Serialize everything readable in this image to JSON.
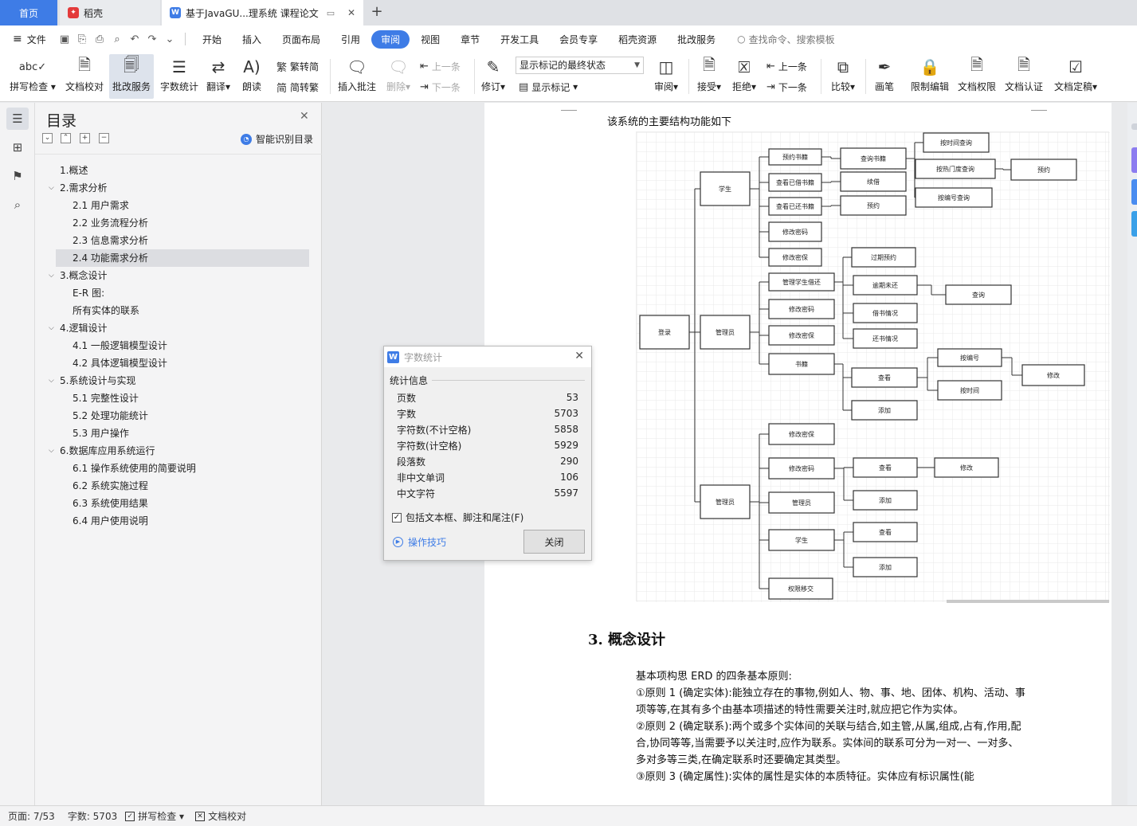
{
  "tabs": {
    "home": "首页",
    "daoke": "稻壳",
    "doc": "基于JavaGU...理系统 课程论文",
    "add": "+"
  },
  "menu": {
    "file": "文件",
    "items": [
      "开始",
      "插入",
      "页面布局",
      "引用",
      "审阅",
      "视图",
      "章节",
      "开发工具",
      "会员专享",
      "稻壳资源",
      "批改服务"
    ],
    "active": "审阅",
    "search": "查找命令、搜索模板"
  },
  "ribbon": {
    "spell_check": "拼写检查",
    "doc_proof": "文档校对",
    "correction_service": "批改服务",
    "word_count": "字数统计",
    "translate": "翻译",
    "read_aloud": "朗读",
    "trad_to_simp": "繁转简",
    "simp_to_trad": "简转繁",
    "insert_comment": "插入批注",
    "delete": "删除",
    "prev": "上一条",
    "next": "下一条",
    "revise": "修订",
    "markup_state": "显示标记的最终状态",
    "show_markup": "显示标记",
    "review": "审阅",
    "accept": "接受",
    "reject": "拒绝",
    "prev2": "上一条",
    "next2": "下一条",
    "compare": "比较",
    "pen": "画笔",
    "restrict_edit": "限制编辑",
    "doc_permission": "文档权限",
    "doc_cert": "文档认证",
    "doc_finalize": "文档定稿"
  },
  "toc": {
    "title": "目录",
    "smart": "智能识别目录",
    "items": [
      {
        "text": "1.概述",
        "level": 1,
        "caret": ""
      },
      {
        "text": "2.需求分析",
        "level": 1,
        "caret": "⌵"
      },
      {
        "text": "2.1 用户需求",
        "level": 2,
        "caret": ""
      },
      {
        "text": "2.2 业务流程分析",
        "level": 2,
        "caret": ""
      },
      {
        "text": "2.3 信息需求分析",
        "level": 2,
        "caret": ""
      },
      {
        "text": "2.4 功能需求分析",
        "level": 2,
        "caret": ""
      },
      {
        "text": "3.概念设计",
        "level": 1,
        "caret": "⌵"
      },
      {
        "text": "E-R 图:",
        "level": 2,
        "caret": ""
      },
      {
        "text": "所有实体的联系",
        "level": 2,
        "caret": ""
      },
      {
        "text": "4.逻辑设计",
        "level": 1,
        "caret": "⌵"
      },
      {
        "text": "4.1 一般逻辑模型设计",
        "level": 2,
        "caret": ""
      },
      {
        "text": "4.2 具体逻辑模型设计",
        "level": 2,
        "caret": ""
      },
      {
        "text": "5.系统设计与实现",
        "level": 1,
        "caret": "⌵"
      },
      {
        "text": "5.1 完整性设计",
        "level": 2,
        "caret": ""
      },
      {
        "text": "5.2 处理功能统计",
        "level": 2,
        "caret": ""
      },
      {
        "text": "5.3 用户操作",
        "level": 2,
        "caret": ""
      },
      {
        "text": "6.数据库应用系统运行",
        "level": 1,
        "caret": "⌵"
      },
      {
        "text": "6.1 操作系统使用的简要说明",
        "level": 2,
        "caret": ""
      },
      {
        "text": "6.2 系统实施过程",
        "level": 2,
        "caret": ""
      },
      {
        "text": "6.3 系统使用结果",
        "level": 2,
        "caret": ""
      },
      {
        "text": "6.4 用户使用说明",
        "level": 2,
        "caret": ""
      }
    ],
    "selected": "2.4 功能需求分析"
  },
  "doc": {
    "intro": "该系统的主要结构功能如下",
    "section_heading": "3. 概念设计",
    "paragraphs": [
      "基本项构思 ERD 的四条基本原则:",
      "①原则 1 (确定实体):能独立存在的事物,例如人、物、事、地、团体、机构、活动、事项等等,在其有多个由基本项描述的特性需要关注时,就应把它作为实体。",
      "②原则 2 (确定联系):两个或多个实体间的关联与结合,如主管,从属,组成,占有,作用,配合,协同等等,当需要予以关注时,应作为联系。实体间的联系可分为一对一、一对多、多对多等三类,在确定联系时还要确定其类型。",
      "③原则 3 (确定属性):实体的属性是实体的本质特征。实体应有标识属性(能"
    ]
  },
  "diagram": {
    "nodes": {
      "login": "登录",
      "student": "学生",
      "librarian": "管理员",
      "admin": "管理员",
      "reserve_book": "预约书籍",
      "view_borrowed": "查看已借书籍",
      "view_returned": "查看已还书籍",
      "change_pwd_s": "修改密码",
      "change_info_s": "修改密保",
      "query_book": "查询书籍",
      "renew": "续借",
      "reserve": "预约",
      "by_time": "按时间查询",
      "by_popular": "按热门度查询",
      "by_number": "按编号查询",
      "reserve_r": "预约",
      "manage_return": "管理学生借还",
      "change_pwd_l": "修改密码",
      "change_info_l": "修改密保",
      "books": "书籍",
      "overdue_reserve": "过期预约",
      "overdue_return": "逾期未还",
      "borrow_status": "借书情况",
      "return_status": "还书情况",
      "query_r": "查询",
      "view_l": "查看",
      "add_l": "添加",
      "by_number2": "按编号",
      "by_time2": "按时间",
      "modify_l": "修改",
      "change_info_a": "修改密保",
      "change_pwd_a": "修改密码",
      "manage_admin": "管理员",
      "student_a": "学生",
      "perm_transfer": "权限移交",
      "view_a1": "查看",
      "add_a1": "添加",
      "modify_a": "修改",
      "view_a2": "查看",
      "add_a2": "添加"
    }
  },
  "dialog": {
    "title": "字数统计",
    "group": "统计信息",
    "rows": [
      {
        "label": "页数",
        "value": "53"
      },
      {
        "label": "字数",
        "value": "5703"
      },
      {
        "label": "字符数(不计空格)",
        "value": "5858"
      },
      {
        "label": "字符数(计空格)",
        "value": "5929"
      },
      {
        "label": "段落数",
        "value": "290"
      },
      {
        "label": "非中文单词",
        "value": "106"
      },
      {
        "label": "中文字符",
        "value": "5597"
      }
    ],
    "include_label": "包括文本框、脚注和尾注(F)",
    "include_checked": true,
    "tips": "操作技巧",
    "close": "关闭"
  },
  "status": {
    "page": "页面: 7/53",
    "words": "字数: 5703",
    "spell": "拼写检查",
    "proof": "文档校对"
  },
  "colors": {
    "accent": "#3e7ce6",
    "daoke": "#e33a3a"
  }
}
